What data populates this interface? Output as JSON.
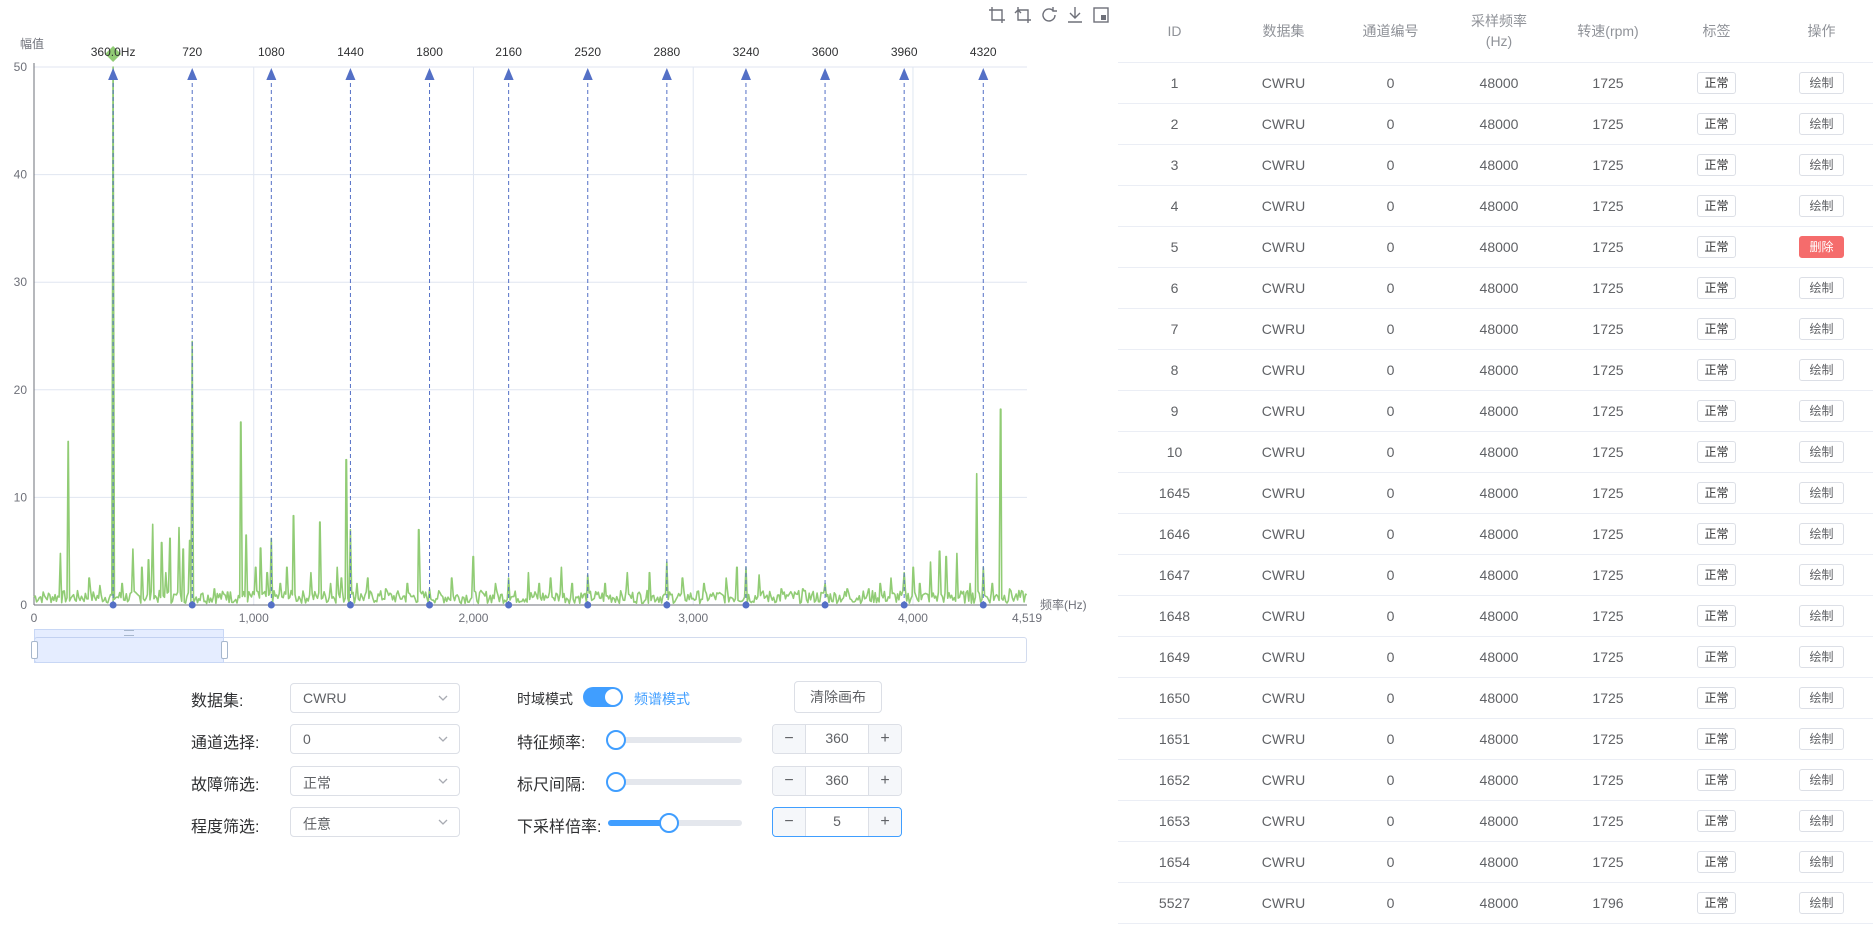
{
  "toolbar": {
    "icons": [
      "crop-icon",
      "crop-reset-icon",
      "refresh-icon",
      "download-icon",
      "data-view-icon"
    ]
  },
  "chart_data": {
    "type": "line",
    "y_axis_name": "幅值",
    "x_axis_name": "频率(Hz)",
    "xlim": [
      0,
      4519
    ],
    "ylim": [
      0,
      50
    ],
    "y_ticks": [
      "0",
      "10",
      "20",
      "30",
      "40",
      "50"
    ],
    "x_ticks": [
      {
        "v": 0,
        "label": "0"
      },
      {
        "v": 1000,
        "label": "1,000"
      },
      {
        "v": 2000,
        "label": "2,000"
      },
      {
        "v": 3000,
        "label": "3,000"
      },
      {
        "v": 4000,
        "label": "4,000"
      },
      {
        "v": 4519,
        "label": "4,519"
      }
    ],
    "grid": true,
    "line_color": "#91cc75",
    "marker_color": "#5470c6",
    "highlight_marker": {
      "value": 360,
      "label": "360.0Hz",
      "color": "#91cc75"
    },
    "markers": [
      {
        "value": 720,
        "label": "720"
      },
      {
        "value": 1080,
        "label": "1080"
      },
      {
        "value": 1440,
        "label": "1440"
      },
      {
        "value": 1800,
        "label": "1800"
      },
      {
        "value": 2160,
        "label": "2160"
      },
      {
        "value": 2520,
        "label": "2520"
      },
      {
        "value": 2880,
        "label": "2880"
      },
      {
        "value": 3240,
        "label": "3240"
      },
      {
        "value": 3600,
        "label": "3600"
      },
      {
        "value": 3960,
        "label": "3960"
      },
      {
        "value": 4320,
        "label": "4320"
      }
    ],
    "peaks": [
      [
        120,
        4.8
      ],
      [
        155,
        15.2
      ],
      [
        250,
        2.5
      ],
      [
        300,
        1.8
      ],
      [
        360,
        50
      ],
      [
        400,
        2
      ],
      [
        450,
        5.2
      ],
      [
        490,
        3.5
      ],
      [
        520,
        4.2
      ],
      [
        540,
        7.5
      ],
      [
        580,
        5.8
      ],
      [
        600,
        3
      ],
      [
        620,
        6.2
      ],
      [
        660,
        7.2
      ],
      [
        680,
        5.2
      ],
      [
        710,
        6
      ],
      [
        720,
        24.5
      ],
      [
        760,
        1
      ],
      [
        820,
        1.5
      ],
      [
        880,
        1.2
      ],
      [
        940,
        17
      ],
      [
        965,
        6.5
      ],
      [
        1010,
        3.5
      ],
      [
        1030,
        5.3
      ],
      [
        1060,
        3
      ],
      [
        1080,
        6.2
      ],
      [
        1120,
        2
      ],
      [
        1150,
        3.5
      ],
      [
        1180,
        8.3
      ],
      [
        1260,
        3
      ],
      [
        1300,
        7.7
      ],
      [
        1350,
        2
      ],
      [
        1380,
        3.5
      ],
      [
        1400,
        2.5
      ],
      [
        1420,
        13.5
      ],
      [
        1440,
        7
      ],
      [
        1470,
        2
      ],
      [
        1520,
        2.5
      ],
      [
        1600,
        1.5
      ],
      [
        1700,
        2
      ],
      [
        1750,
        7
      ],
      [
        1800,
        1.5
      ],
      [
        1900,
        2.5
      ],
      [
        2000,
        4.5
      ],
      [
        2100,
        2
      ],
      [
        2160,
        2.5
      ],
      [
        2250,
        3
      ],
      [
        2300,
        2
      ],
      [
        2350,
        2.5
      ],
      [
        2400,
        3.5
      ],
      [
        2450,
        2
      ],
      [
        2520,
        2.8
      ],
      [
        2600,
        2
      ],
      [
        2700,
        3
      ],
      [
        2800,
        3
      ],
      [
        2880,
        4
      ],
      [
        2950,
        2.5
      ],
      [
        3050,
        2
      ],
      [
        3150,
        2.5
      ],
      [
        3200,
        3.5
      ],
      [
        3240,
        3.5
      ],
      [
        3300,
        2.8
      ],
      [
        3400,
        1.5
      ],
      [
        3500,
        1.5
      ],
      [
        3600,
        2
      ],
      [
        3700,
        1.5
      ],
      [
        3800,
        1.5
      ],
      [
        3850,
        2
      ],
      [
        3900,
        2.5
      ],
      [
        3960,
        3
      ],
      [
        4000,
        3.5
      ],
      [
        4030,
        2
      ],
      [
        4080,
        4
      ],
      [
        4120,
        5
      ],
      [
        4150,
        4.5
      ],
      [
        4200,
        4.8
      ],
      [
        4260,
        2
      ],
      [
        4290,
        12.2
      ],
      [
        4320,
        3.5
      ],
      [
        4360,
        2
      ],
      [
        4400,
        18.2
      ],
      [
        4440,
        1.5
      ],
      [
        4480,
        1
      ]
    ]
  },
  "controls": {
    "dataset": {
      "label": "数据集:",
      "value": "CWRU"
    },
    "channel": {
      "label": "通道选择:",
      "value": "0"
    },
    "fault": {
      "label": "故障筛选:",
      "value": "正常"
    },
    "degree": {
      "label": "程度筛选:",
      "value": "任意"
    },
    "mode_left": "时域模式",
    "mode_right": "频谱模式",
    "mode_is_frequency": true,
    "clear_button": "清除画布",
    "feature_freq": {
      "label": "特征频率:",
      "value": "360",
      "fraction": 0.0
    },
    "ruler_gap": {
      "label": "标尺间隔:",
      "value": "360",
      "fraction": 0.0
    },
    "downsample": {
      "label": "下采样倍率:",
      "value": "5",
      "fraction": 0.4
    },
    "minus_glyph": "−",
    "plus_glyph": "+"
  },
  "table": {
    "headers": [
      "ID",
      "数据集",
      "通道编号",
      "采样频率\n(Hz)",
      "转速(rpm)",
      "标签",
      "操作"
    ],
    "rows": [
      {
        "id": "1",
        "dataset": "CWRU",
        "channel": "0",
        "rate": "48000",
        "rpm": "1725",
        "tag": "正常",
        "action": "绘制",
        "danger": false
      },
      {
        "id": "2",
        "dataset": "CWRU",
        "channel": "0",
        "rate": "48000",
        "rpm": "1725",
        "tag": "正常",
        "action": "绘制",
        "danger": false
      },
      {
        "id": "3",
        "dataset": "CWRU",
        "channel": "0",
        "rate": "48000",
        "rpm": "1725",
        "tag": "正常",
        "action": "绘制",
        "danger": false
      },
      {
        "id": "4",
        "dataset": "CWRU",
        "channel": "0",
        "rate": "48000",
        "rpm": "1725",
        "tag": "正常",
        "action": "绘制",
        "danger": false
      },
      {
        "id": "5",
        "dataset": "CWRU",
        "channel": "0",
        "rate": "48000",
        "rpm": "1725",
        "tag": "正常",
        "action": "删除",
        "danger": true
      },
      {
        "id": "6",
        "dataset": "CWRU",
        "channel": "0",
        "rate": "48000",
        "rpm": "1725",
        "tag": "正常",
        "action": "绘制",
        "danger": false
      },
      {
        "id": "7",
        "dataset": "CWRU",
        "channel": "0",
        "rate": "48000",
        "rpm": "1725",
        "tag": "正常",
        "action": "绘制",
        "danger": false
      },
      {
        "id": "8",
        "dataset": "CWRU",
        "channel": "0",
        "rate": "48000",
        "rpm": "1725",
        "tag": "正常",
        "action": "绘制",
        "danger": false
      },
      {
        "id": "9",
        "dataset": "CWRU",
        "channel": "0",
        "rate": "48000",
        "rpm": "1725",
        "tag": "正常",
        "action": "绘制",
        "danger": false
      },
      {
        "id": "10",
        "dataset": "CWRU",
        "channel": "0",
        "rate": "48000",
        "rpm": "1725",
        "tag": "正常",
        "action": "绘制",
        "danger": false
      },
      {
        "id": "1645",
        "dataset": "CWRU",
        "channel": "0",
        "rate": "48000",
        "rpm": "1725",
        "tag": "正常",
        "action": "绘制",
        "danger": false
      },
      {
        "id": "1646",
        "dataset": "CWRU",
        "channel": "0",
        "rate": "48000",
        "rpm": "1725",
        "tag": "正常",
        "action": "绘制",
        "danger": false
      },
      {
        "id": "1647",
        "dataset": "CWRU",
        "channel": "0",
        "rate": "48000",
        "rpm": "1725",
        "tag": "正常",
        "action": "绘制",
        "danger": false
      },
      {
        "id": "1648",
        "dataset": "CWRU",
        "channel": "0",
        "rate": "48000",
        "rpm": "1725",
        "tag": "正常",
        "action": "绘制",
        "danger": false
      },
      {
        "id": "1649",
        "dataset": "CWRU",
        "channel": "0",
        "rate": "48000",
        "rpm": "1725",
        "tag": "正常",
        "action": "绘制",
        "danger": false
      },
      {
        "id": "1650",
        "dataset": "CWRU",
        "channel": "0",
        "rate": "48000",
        "rpm": "1725",
        "tag": "正常",
        "action": "绘制",
        "danger": false
      },
      {
        "id": "1651",
        "dataset": "CWRU",
        "channel": "0",
        "rate": "48000",
        "rpm": "1725",
        "tag": "正常",
        "action": "绘制",
        "danger": false
      },
      {
        "id": "1652",
        "dataset": "CWRU",
        "channel": "0",
        "rate": "48000",
        "rpm": "1725",
        "tag": "正常",
        "action": "绘制",
        "danger": false
      },
      {
        "id": "1653",
        "dataset": "CWRU",
        "channel": "0",
        "rate": "48000",
        "rpm": "1725",
        "tag": "正常",
        "action": "绘制",
        "danger": false
      },
      {
        "id": "1654",
        "dataset": "CWRU",
        "channel": "0",
        "rate": "48000",
        "rpm": "1725",
        "tag": "正常",
        "action": "绘制",
        "danger": false
      },
      {
        "id": "5527",
        "dataset": "CWRU",
        "channel": "0",
        "rate": "48000",
        "rpm": "1796",
        "tag": "正常",
        "action": "绘制",
        "danger": false
      }
    ]
  }
}
